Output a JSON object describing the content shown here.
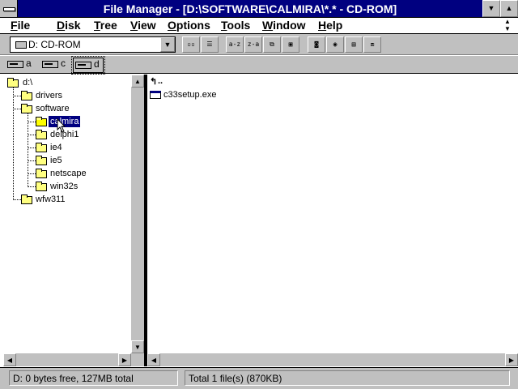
{
  "window": {
    "title": "File Manager - [D:\\SOFTWARE\\CALMIRA\\*.* - CD-ROM]"
  },
  "menu": [
    {
      "key": "F",
      "rest": "ile"
    },
    {
      "key": "D",
      "rest": "isk"
    },
    {
      "key": "T",
      "rest": "ree"
    },
    {
      "key": "V",
      "rest": "iew"
    },
    {
      "key": "O",
      "rest": "ptions"
    },
    {
      "key": "T",
      "rest": "ools"
    },
    {
      "key": "W",
      "rest": "indow"
    },
    {
      "key": "H",
      "rest": "elp"
    }
  ],
  "toolbar": {
    "drive_combo": "D: CD-ROM",
    "buttons": [
      "connect-drive",
      "disconnect-drive",
      "tree-only",
      "details-view",
      "sort-name",
      "sort-type",
      "copy",
      "move",
      "network-connect",
      "share",
      "share-stop",
      "print",
      "run"
    ]
  },
  "drives": [
    {
      "letter": "a",
      "selected": false
    },
    {
      "letter": "c",
      "selected": false
    },
    {
      "letter": "d",
      "selected": true
    }
  ],
  "tree": [
    {
      "label": "d:\\",
      "level": 0
    },
    {
      "label": "drivers",
      "level": 1
    },
    {
      "label": "software",
      "level": 1
    },
    {
      "label": "calmira",
      "level": 2,
      "selected": true
    },
    {
      "label": "delphi1",
      "level": 2
    },
    {
      "label": "ie4",
      "level": 2
    },
    {
      "label": "ie5",
      "level": 2
    },
    {
      "label": "netscape",
      "level": 2
    },
    {
      "label": "win32s",
      "level": 2
    },
    {
      "label": "wfw311",
      "level": 1
    }
  ],
  "files": [
    {
      "label": "..",
      "type": "up"
    },
    {
      "label": "c33setup.exe",
      "type": "exe"
    }
  ],
  "status": {
    "left": "D: 0 bytes free,  127MB total",
    "right": "Total 1 file(s) (870KB)"
  }
}
